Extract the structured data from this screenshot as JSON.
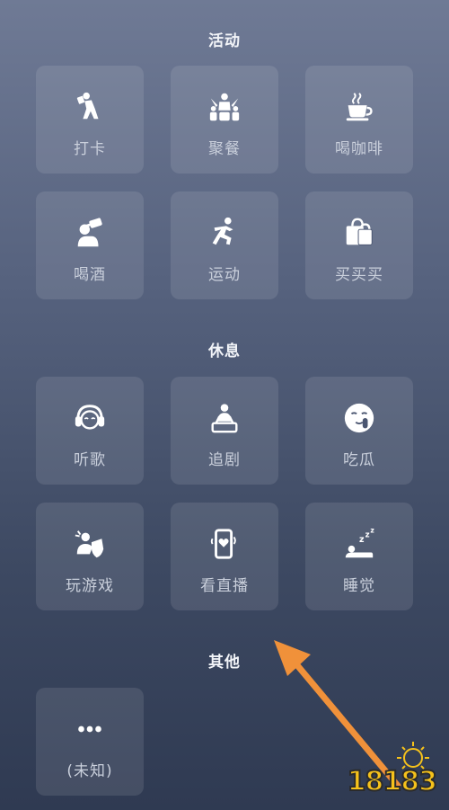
{
  "sections": [
    {
      "title": "活动",
      "items": [
        {
          "label": "打卡",
          "icon": "check-in-person-icon"
        },
        {
          "label": "聚餐",
          "icon": "dinner-party-icon"
        },
        {
          "label": "喝咖啡",
          "icon": "coffee-cup-icon"
        },
        {
          "label": "喝酒",
          "icon": "drink-beer-icon"
        },
        {
          "label": "运动",
          "icon": "running-person-icon"
        },
        {
          "label": "买买买",
          "icon": "shopping-bag-icon"
        }
      ]
    },
    {
      "title": "休息",
      "items": [
        {
          "label": "听歌",
          "icon": "headphones-icon"
        },
        {
          "label": "追剧",
          "icon": "watching-tv-icon"
        },
        {
          "label": "吃瓜",
          "icon": "shush-face-icon"
        },
        {
          "label": "玩游戏",
          "icon": "gamer-shield-icon"
        },
        {
          "label": "看直播",
          "icon": "live-stream-phone-icon"
        },
        {
          "label": "睡觉",
          "icon": "sleeping-zzz-icon"
        }
      ]
    },
    {
      "title": "其他",
      "items": [
        {
          "label": "(未知)",
          "icon": "more-dots-icon"
        }
      ]
    }
  ],
  "watermark": {
    "text": "18183"
  },
  "colors": {
    "accent_arrow": "#f0913a",
    "watermark": "#f6c21b"
  }
}
